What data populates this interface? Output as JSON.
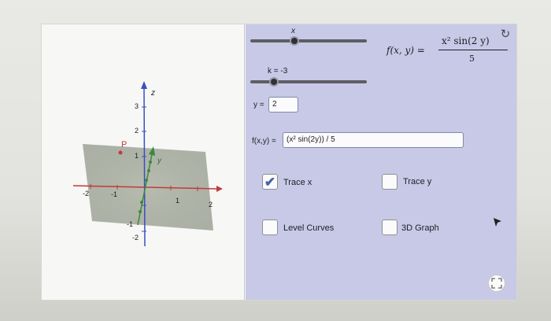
{
  "sliders": {
    "x": {
      "label": "x"
    },
    "k": {
      "label": "k = -3",
      "value": -3
    }
  },
  "inputs": {
    "y_label": "y =",
    "y_value": "2",
    "f_label": "f(x,y) =",
    "f_value": "(x² sin(2y)) / 5"
  },
  "formula": {
    "lhs": "f(x, y) =",
    "numerator": "x² sin(2 y)",
    "denominator": "5"
  },
  "checkboxes": [
    {
      "label": "Trace x",
      "checked": true
    },
    {
      "label": "Trace y",
      "checked": false
    },
    {
      "label": "Level Curves",
      "checked": false
    },
    {
      "label": "3D Graph",
      "checked": false
    }
  ],
  "axes": {
    "z_label": "z",
    "y_label": "y",
    "point_label": "P",
    "z_ticks": [
      "3",
      "2",
      "1",
      "-1",
      "-2"
    ],
    "x_ticks": [
      "-2",
      "-1",
      "1",
      "2"
    ]
  },
  "icons": {
    "refresh": "refresh-icon",
    "fullscreen": "fullscreen-icon",
    "cursor": "cursor-icon"
  },
  "colors": {
    "panel": "#c7c9e6",
    "axis": "#3b4fc0",
    "x_axis": "#c03b3b",
    "point": "#c03b3b",
    "trace": "#3a8a3a",
    "plane": "#8e9683"
  }
}
